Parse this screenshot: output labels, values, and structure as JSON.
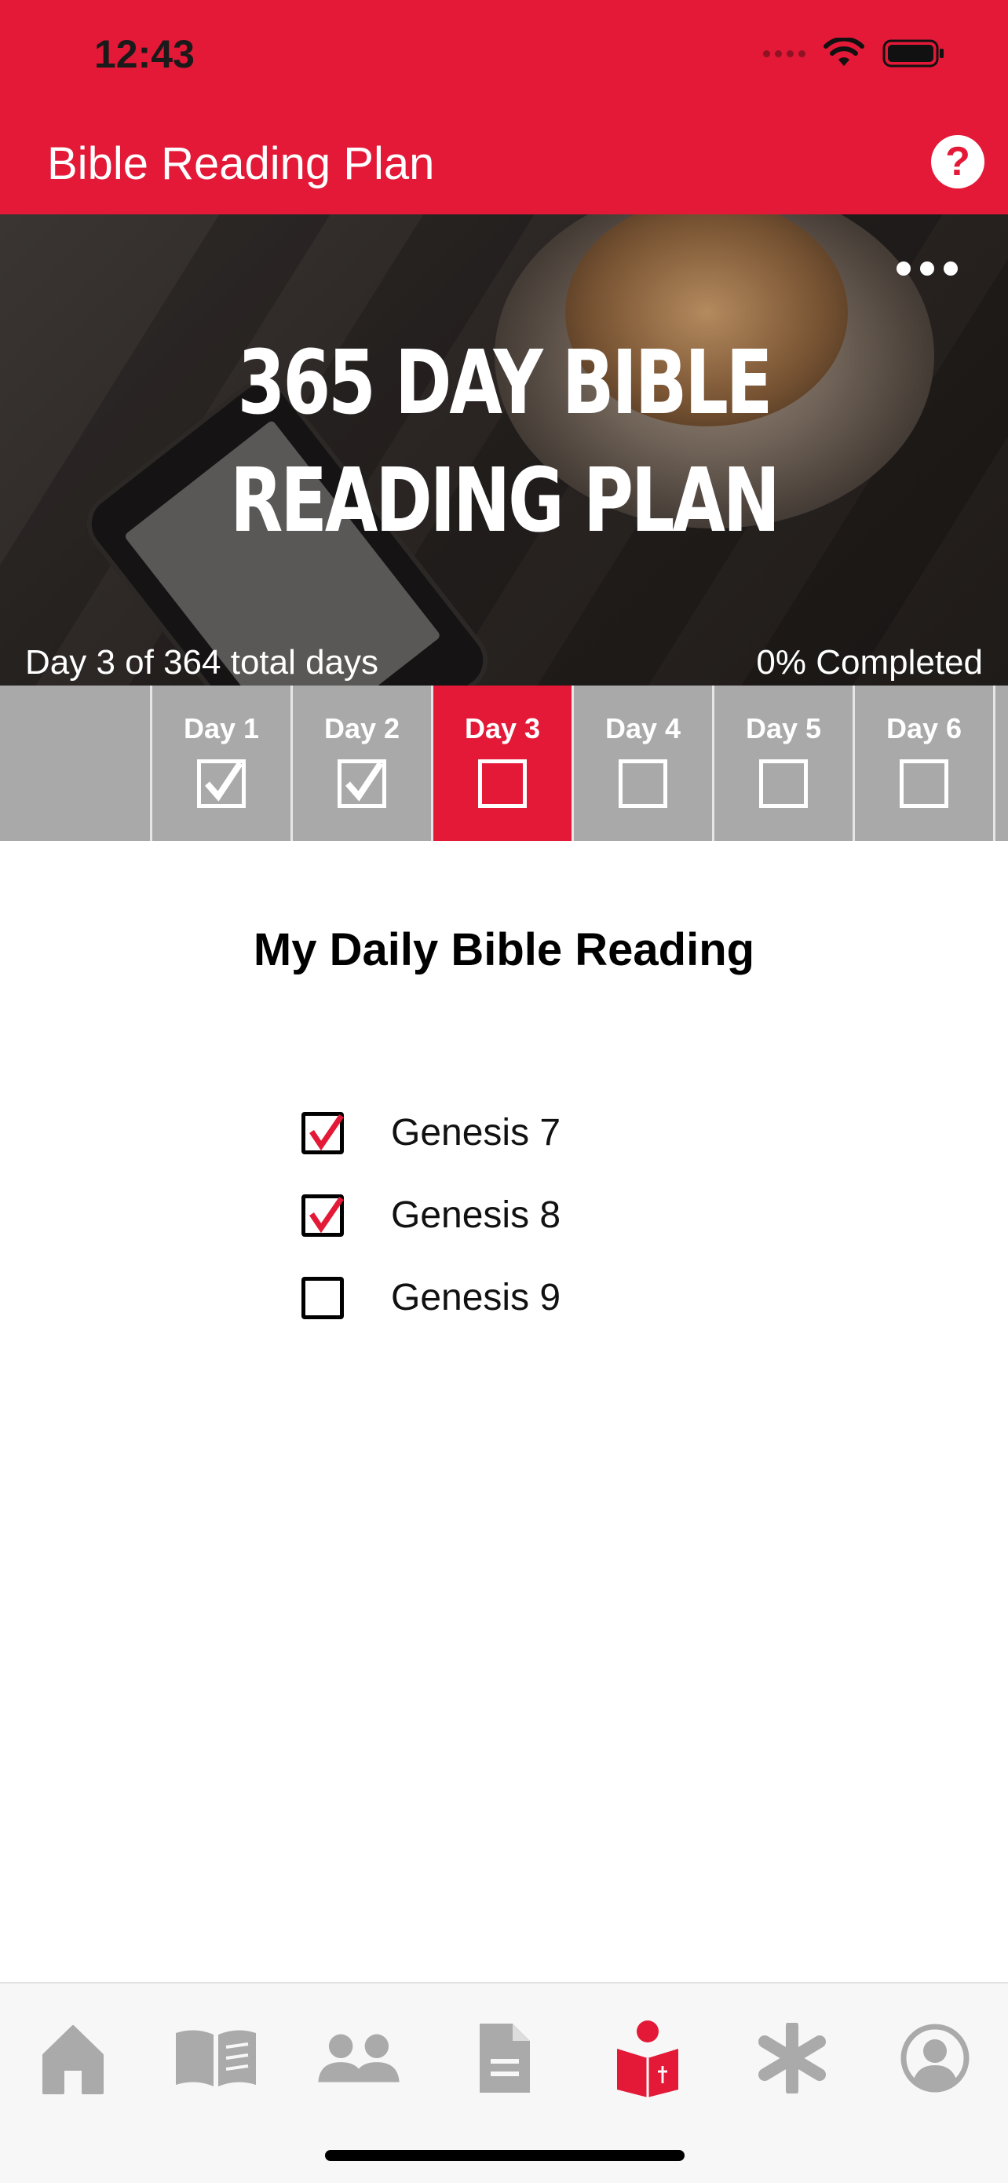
{
  "status_bar": {
    "time": "12:43"
  },
  "nav": {
    "title": "Bible Reading Plan",
    "help_icon": "question-circle-icon",
    "help_label": "?"
  },
  "hero": {
    "title": "365 DAY BIBLE READING PLAN",
    "progress_left": "Day 3 of 364 total days",
    "progress_right": "0% Completed",
    "menu_icon": "more-dots-icon"
  },
  "days": [
    {
      "label": "Day 1",
      "checked": true,
      "active": false
    },
    {
      "label": "Day 2",
      "checked": true,
      "active": false
    },
    {
      "label": "Day 3",
      "checked": false,
      "active": true
    },
    {
      "label": "Day 4",
      "checked": false,
      "active": false
    },
    {
      "label": "Day 5",
      "checked": false,
      "active": false
    },
    {
      "label": "Day 6",
      "checked": false,
      "active": false
    }
  ],
  "content": {
    "heading": "My Daily Bible Reading",
    "readings": [
      {
        "label": "Genesis 7",
        "checked": true
      },
      {
        "label": "Genesis 8",
        "checked": true
      },
      {
        "label": "Genesis 9",
        "checked": false
      }
    ]
  },
  "tabbar": {
    "items": [
      {
        "name": "home",
        "icon": "home-icon",
        "active": false
      },
      {
        "name": "bible",
        "icon": "open-book-icon",
        "active": false
      },
      {
        "name": "community",
        "icon": "people-icon",
        "active": false
      },
      {
        "name": "notes",
        "icon": "document-icon",
        "active": false
      },
      {
        "name": "reading-plan",
        "icon": "reader-icon",
        "active": true
      },
      {
        "name": "more",
        "icon": "asterisk-icon",
        "active": false
      },
      {
        "name": "profile",
        "icon": "user-circle-icon",
        "active": false
      }
    ]
  },
  "colors": {
    "brand": "#e31937",
    "strip": "#a9a9a9",
    "tab_inactive": "#aaaaaa"
  }
}
